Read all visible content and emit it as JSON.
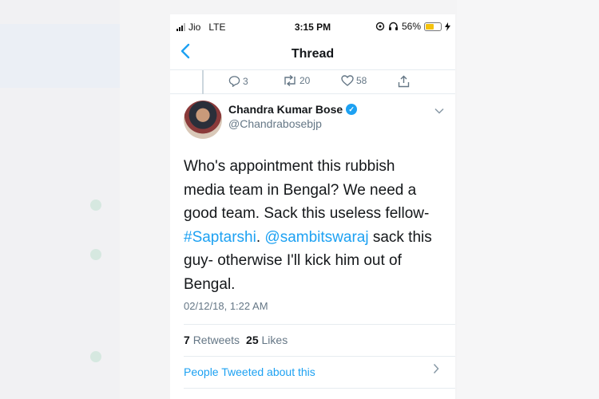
{
  "status_bar": {
    "carrier": "Jio",
    "network": "LTE",
    "time": "3:15 PM",
    "battery_percent": "56%",
    "battery_level": 0.56,
    "battery_color": "#f4c20d"
  },
  "nav": {
    "title": "Thread"
  },
  "previous_tweet_actions": {
    "replies": "3",
    "retweets": "20",
    "likes": "58"
  },
  "tweet": {
    "author_name": "Chandra Kumar Bose",
    "handle": "@Chandrabosebjp",
    "text_part1": "Who's appointment this rubbish media team in Bengal? We need a good team. Sack this useless fellow-",
    "hashtag": "#Saptarshi",
    "text_part2": ". ",
    "mention": "@sambitswaraj",
    "text_part3": " sack this guy- otherwise I'll kick him out of Bengal.",
    "timestamp": "02/12/18, 1:22 AM",
    "retweet_count": "7",
    "retweet_label": "Retweets",
    "like_count": "25",
    "like_label": "Likes",
    "people_tweeted": "People Tweeted about this"
  },
  "colors": {
    "accent": "#1da1f2",
    "secondary_text": "#657786"
  }
}
